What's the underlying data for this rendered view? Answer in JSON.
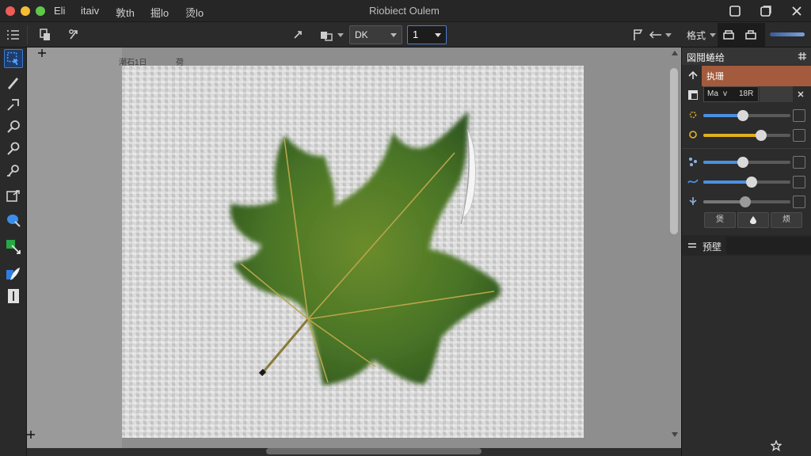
{
  "window": {
    "title": "Riobiect   Oulem",
    "menu": [
      "Eli",
      "itaiv",
      "敦th",
      "掘lo",
      "烫lo"
    ]
  },
  "toolbar": {
    "mode_select": "DK",
    "number_value": "1",
    "right_label": "格式"
  },
  "document": {
    "label": "潮石1日",
    "sub_label": "荷"
  },
  "panel": {
    "tab_label": "図鬩蜷给",
    "layer_name": "执珊",
    "field_a": "Ma",
    "field_b": "v",
    "field_c": "18R",
    "section_label": "预壁",
    "btn_left": "煲",
    "btn_right": "烦"
  },
  "sliders": [
    {
      "name": "slider-1",
      "value": 0.45,
      "color": "#4a90e2"
    },
    {
      "name": "slider-2",
      "value": 0.66,
      "color": "#e0b020"
    },
    {
      "name": "slider-3",
      "value": 0.45,
      "color": "#4a90e2"
    },
    {
      "name": "slider-4",
      "value": 0.55,
      "color": "#4a90e2"
    },
    {
      "name": "slider-5",
      "value": 0.48,
      "color": "#777777"
    }
  ],
  "colors": {
    "accent": "#4a90e2",
    "layer_highlight": "#a45a3c",
    "leaf_green": "#4e7a2a"
  }
}
